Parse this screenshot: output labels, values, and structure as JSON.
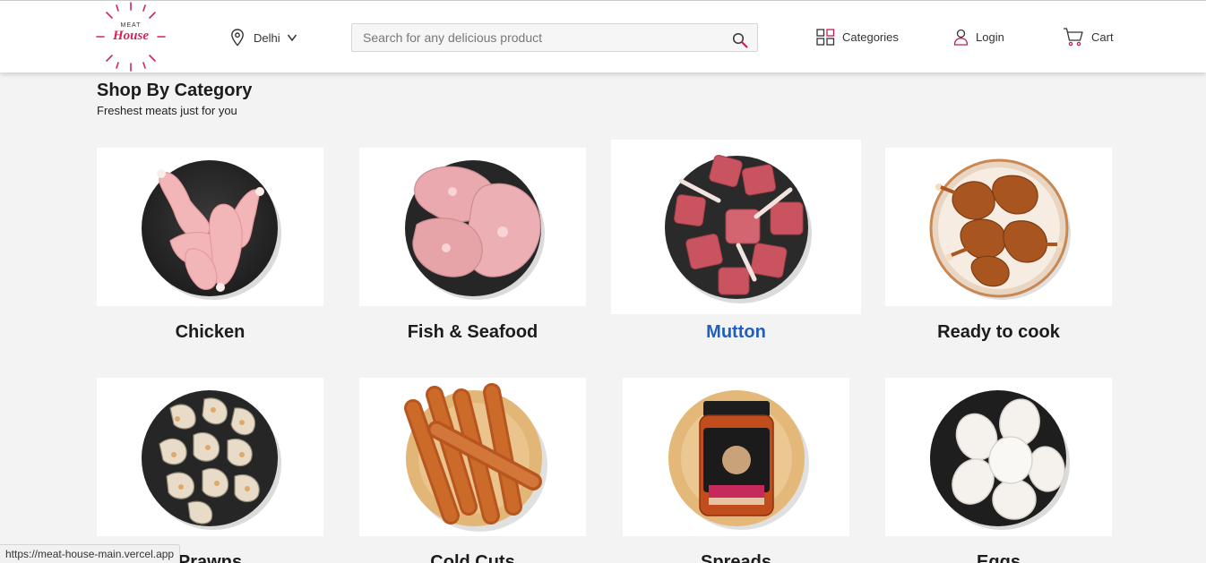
{
  "header": {
    "logo": {
      "top_word": "MEAT",
      "brand_word": "House"
    },
    "location": {
      "city": "Delhi",
      "pin_icon": "map-pin-icon",
      "dropdown_icon": "chevron-down-icon"
    },
    "search": {
      "placeholder": "Search for any delicious product",
      "value": "",
      "icon": "search-icon"
    },
    "nav": {
      "categories_label": "Categories",
      "login_label": "Login",
      "cart_label": "Cart"
    }
  },
  "section": {
    "title": "Shop By Category",
    "subtitle": "Freshest meats just for you"
  },
  "categories": [
    {
      "label": "Chicken"
    },
    {
      "label": "Fish & Seafood"
    },
    {
      "label": "Mutton"
    },
    {
      "label": "Ready to cook"
    },
    {
      "label": "Prawns"
    },
    {
      "label": "Cold Cuts"
    },
    {
      "label": "Spreads"
    },
    {
      "label": "Eggs"
    }
  ],
  "status_url": "https://meat-house-main.vercel.app",
  "colors": {
    "brand": "#d0245a",
    "active_link": "#1f5fbf",
    "background": "#f3f3f3"
  }
}
